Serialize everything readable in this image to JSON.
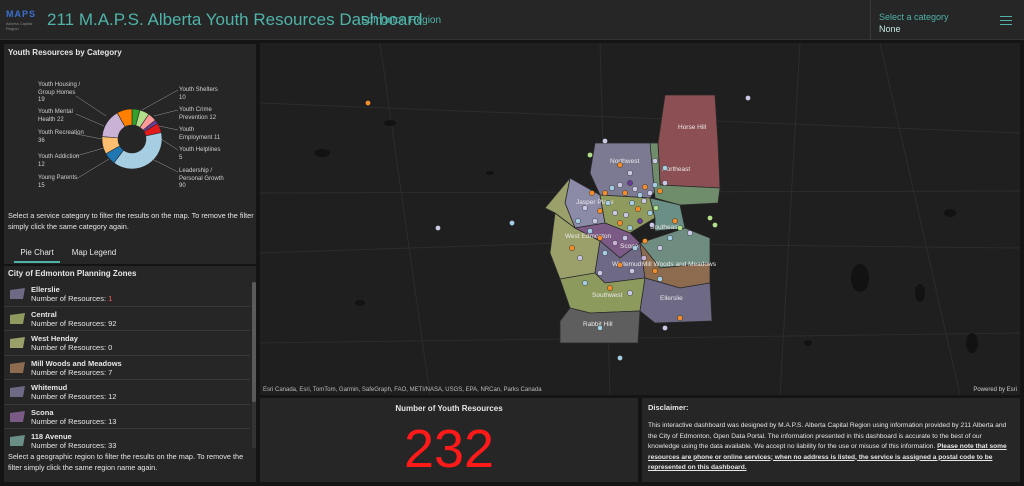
{
  "header": {
    "logo_text": "MAPS",
    "logo_tagline": "Alberta Capital Region",
    "title": "211 M.A.P.S. Alberta Youth Resources Dashboard",
    "subtitle": "Edmonton Region",
    "category_selector": {
      "label": "Select a category",
      "value": "None"
    },
    "menu_icon": "hamburger-menu-icon"
  },
  "pie_panel": {
    "title": "Youth Resources by Category",
    "note": "Select a service category to filter the results on the map. To remove the filter simply click the same category again.",
    "chart_data": {
      "type": "pie",
      "title": "Youth Resources by Category",
      "series": [
        {
          "label": "Leadership / Personal Growth",
          "value": 90,
          "color": "#a6cee3"
        },
        {
          "label": "Youth Recreation",
          "value": 36,
          "color": "#cab2d6"
        },
        {
          "label": "Youth Mental Health",
          "value": 22,
          "color": "#fdbf6f"
        },
        {
          "label": "Youth Housing / Group Homes",
          "value": 19,
          "color": "#ff7f00"
        },
        {
          "label": "Young Parents",
          "value": 15,
          "color": "#1f78b4"
        },
        {
          "label": "Youth Crime Prevention",
          "value": 12,
          "color": "#b2df8a"
        },
        {
          "label": "Youth Addiction",
          "value": 12,
          "color": "#e31a1c"
        },
        {
          "label": "Youth Employment",
          "value": 11,
          "color": "#fb9a99"
        },
        {
          "label": "Youth Shelters",
          "value": 10,
          "color": "#33a02c"
        },
        {
          "label": "Youth Helplines",
          "value": 5,
          "color": "#6a3d9a"
        }
      ]
    },
    "labels": {
      "housing": [
        "Youth Housing /",
        "Group Homes",
        "19"
      ],
      "mental": [
        "Youth Mental",
        "Health 22"
      ],
      "recreation": [
        "Youth Recreation",
        "36"
      ],
      "addiction": [
        "Youth Addiction",
        "12"
      ],
      "parents": [
        "Young Parents",
        "15"
      ],
      "shelters": [
        "Youth Shelters",
        "10"
      ],
      "crime": [
        "Youth Crime",
        "Prevention 12"
      ],
      "employment": [
        "Youth",
        "Employment 11"
      ],
      "helplines": [
        "Youth Helplines",
        "5"
      ],
      "leadership": [
        "Leadership /",
        "Personal Growth",
        "90"
      ]
    }
  },
  "tabs": [
    "Pie Chart",
    "Map Legend"
  ],
  "zones_panel": {
    "title": "City of Edmonton Planning Zones",
    "count_prefix": "Number of Resources: ",
    "zones": [
      {
        "name": "Ellerslie",
        "count": "1",
        "color": "#6e6a86"
      },
      {
        "name": "Central",
        "count": "92",
        "color": "#8e9a5e"
      },
      {
        "name": "West Henday",
        "count": "0",
        "color": "#9ba06a"
      },
      {
        "name": "Mill Woods and Meadows",
        "count": "7",
        "color": "#8c6b4f"
      },
      {
        "name": "Whitemud",
        "count": "12",
        "color": "#6e6a86"
      },
      {
        "name": "Scona",
        "count": "13",
        "color": "#7b5b86"
      },
      {
        "name": "118 Avenue",
        "count": "33",
        "color": "#6a8f86"
      }
    ],
    "note": "Select a geographic region to filter the results on the map. To remove the filter simply click the same region name again."
  },
  "map": {
    "zone_labels": {
      "horse_hill": "Horse Hill",
      "northwest": "Northwest",
      "northeast": "Northeast",
      "jasper_place": "Jasper Place",
      "west_edmonton": "West Edmonton",
      "southeast": "Southeast",
      "whitemud": "Whitemud",
      "mill_woods": "Mill Woods and Meadows",
      "southwest": "Southwest",
      "ellerslie": "Ellerslie",
      "rabbit_hill": "Rabbit Hill",
      "scona": "Scona",
      "central": "Central"
    },
    "attribution": "Esri Canada, Esri, TomTom, Garmin, SafeGraph, FAO, METI/NASA, USGS, EPA, NRCan, Parks Canada",
    "powered_by": "Powered by Esri"
  },
  "count_panel": {
    "title": "Number of Youth Resources",
    "value": "232",
    "value_color": "#ff1a1a"
  },
  "disclaimer": {
    "title": "Disclaimer:",
    "body": "This interactive dashboard was designed by M.A.P.S. Alberta Capital Region using information provided by 211 Alberta and the City of Edmonton, Open Data Portal. The information presented in this dashboard is accurate to the best of our knowledge using the data available. We accept no liability for the use or misuse of this information.",
    "underlined": "Please note that some resources are phone or online services; when no address is listed, the service is assigned a postal code to be represented on this dashboard."
  }
}
